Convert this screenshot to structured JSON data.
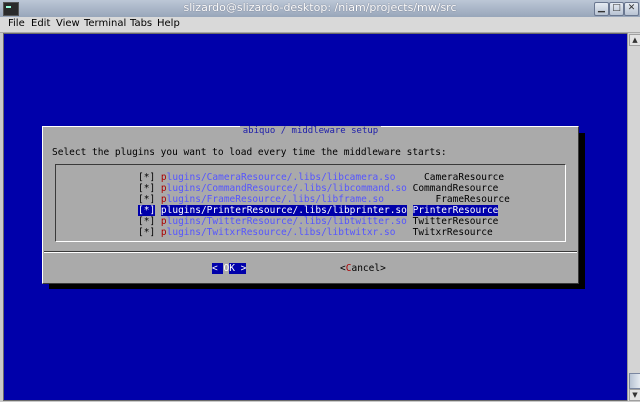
{
  "window": {
    "title": "slizardo@slizardo-desktop: /niam/projects/mw/src",
    "controls": [
      "minimize-icon",
      "maximize-icon",
      "close-icon"
    ]
  },
  "menu": {
    "items": [
      {
        "label": "File"
      },
      {
        "label": "Edit"
      },
      {
        "label": "View"
      },
      {
        "label": "Terminal"
      },
      {
        "label": "Tabs"
      },
      {
        "label": "Help"
      }
    ]
  },
  "dialog": {
    "title": "abiquo / middleware setup",
    "prompt": "Select the plugins you want to load every time the middleware starts:",
    "items": [
      {
        "check": "[*]",
        "hotkey": "p",
        "path": "lugins/CameraResource/.libs/libcamera.so",
        "desc": "CameraResource",
        "selected": false
      },
      {
        "check": "[*]",
        "hotkey": "p",
        "path": "lugins/CommandResource/.libs/libcommand.so",
        "desc": "CommandResource",
        "selected": false
      },
      {
        "check": "[*]",
        "hotkey": "p",
        "path": "lugins/FrameResource/.libs/libframe.so",
        "desc": "FrameResource",
        "selected": false
      },
      {
        "check": "[*]",
        "hotkey": "p",
        "path": "lugins/PrinterResource/.libs/libprinter.so",
        "desc": "PrinterResource",
        "selected": true
      },
      {
        "check": "[*]",
        "hotkey": "p",
        "path": "lugins/TwitterResource/.libs/libtwitter.so",
        "desc": "TwitterResource",
        "selected": false
      },
      {
        "check": "[*]",
        "hotkey": "p",
        "path": "lugins/TwitxrResource/.libs/libtwitxr.so",
        "desc": "TwitxrResource",
        "selected": false
      }
    ],
    "ok": {
      "left": "< ",
      "key": "O",
      "rest": "K",
      "right": " >"
    },
    "cancel": {
      "left": "<",
      "key": "C",
      "rest": "ancel",
      "right": ">"
    }
  },
  "colors": {
    "terminal_bg": "#0000aa",
    "dialog_bg": "#aaaaaa",
    "hotkey": "#aa0000",
    "path": "#5555ff"
  }
}
